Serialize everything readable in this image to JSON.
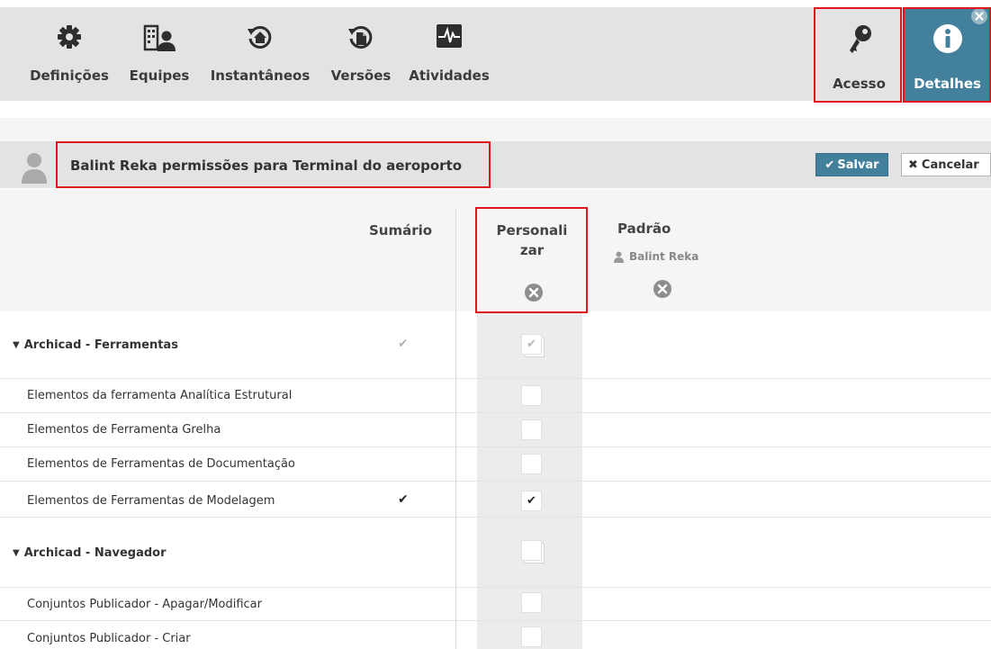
{
  "toolbar": {
    "items": [
      {
        "label": "Definições",
        "icon": "gear-icon"
      },
      {
        "label": "Equipes",
        "icon": "team-icon"
      },
      {
        "label": "Instantâneos",
        "icon": "snapshot-icon"
      },
      {
        "label": "Versões",
        "icon": "versions-icon"
      },
      {
        "label": "Atividades",
        "icon": "activity-icon"
      }
    ],
    "right": {
      "acesso_label": "Acesso",
      "detalhes_label": "Detalhes"
    }
  },
  "header": {
    "title": "Balint Reka permissões para Terminal do aeroporto",
    "save_label": "Salvar",
    "cancel_label": "Cancelar"
  },
  "columns": {
    "summary": "Sumário",
    "custom": "Personali\nzar",
    "default": "Padrão",
    "default_user": "Balint Reka"
  },
  "rows": [
    {
      "label": "Archicad - Ferramentas",
      "group": true,
      "summary": "✔",
      "custom_checked": true
    },
    {
      "label": "Elementos da ferramenta Analítica Estrutural",
      "group": false,
      "summary": "",
      "custom_checked": false
    },
    {
      "label": "Elementos de Ferramenta Grelha",
      "group": false,
      "summary": "",
      "custom_checked": false
    },
    {
      "label": "Elementos de Ferramentas de Documentação",
      "group": false,
      "summary": "",
      "custom_checked": false
    },
    {
      "label": "Elementos de Ferramentas de Modelagem",
      "group": false,
      "summary": "✔",
      "custom_checked": true
    },
    {
      "label": "Archicad - Navegador",
      "group": true,
      "summary": "",
      "custom_checked": false
    },
    {
      "label": "Conjuntos Publicador - Apagar/Modificar",
      "group": false,
      "summary": "",
      "custom_checked": false
    },
    {
      "label": "Conjuntos Publicador - Criar",
      "group": false,
      "summary": "",
      "custom_checked": false
    }
  ],
  "colors": {
    "accent": "#43809b",
    "highlight": "#e0161e",
    "toolbar_bg": "#e3e3e3"
  }
}
